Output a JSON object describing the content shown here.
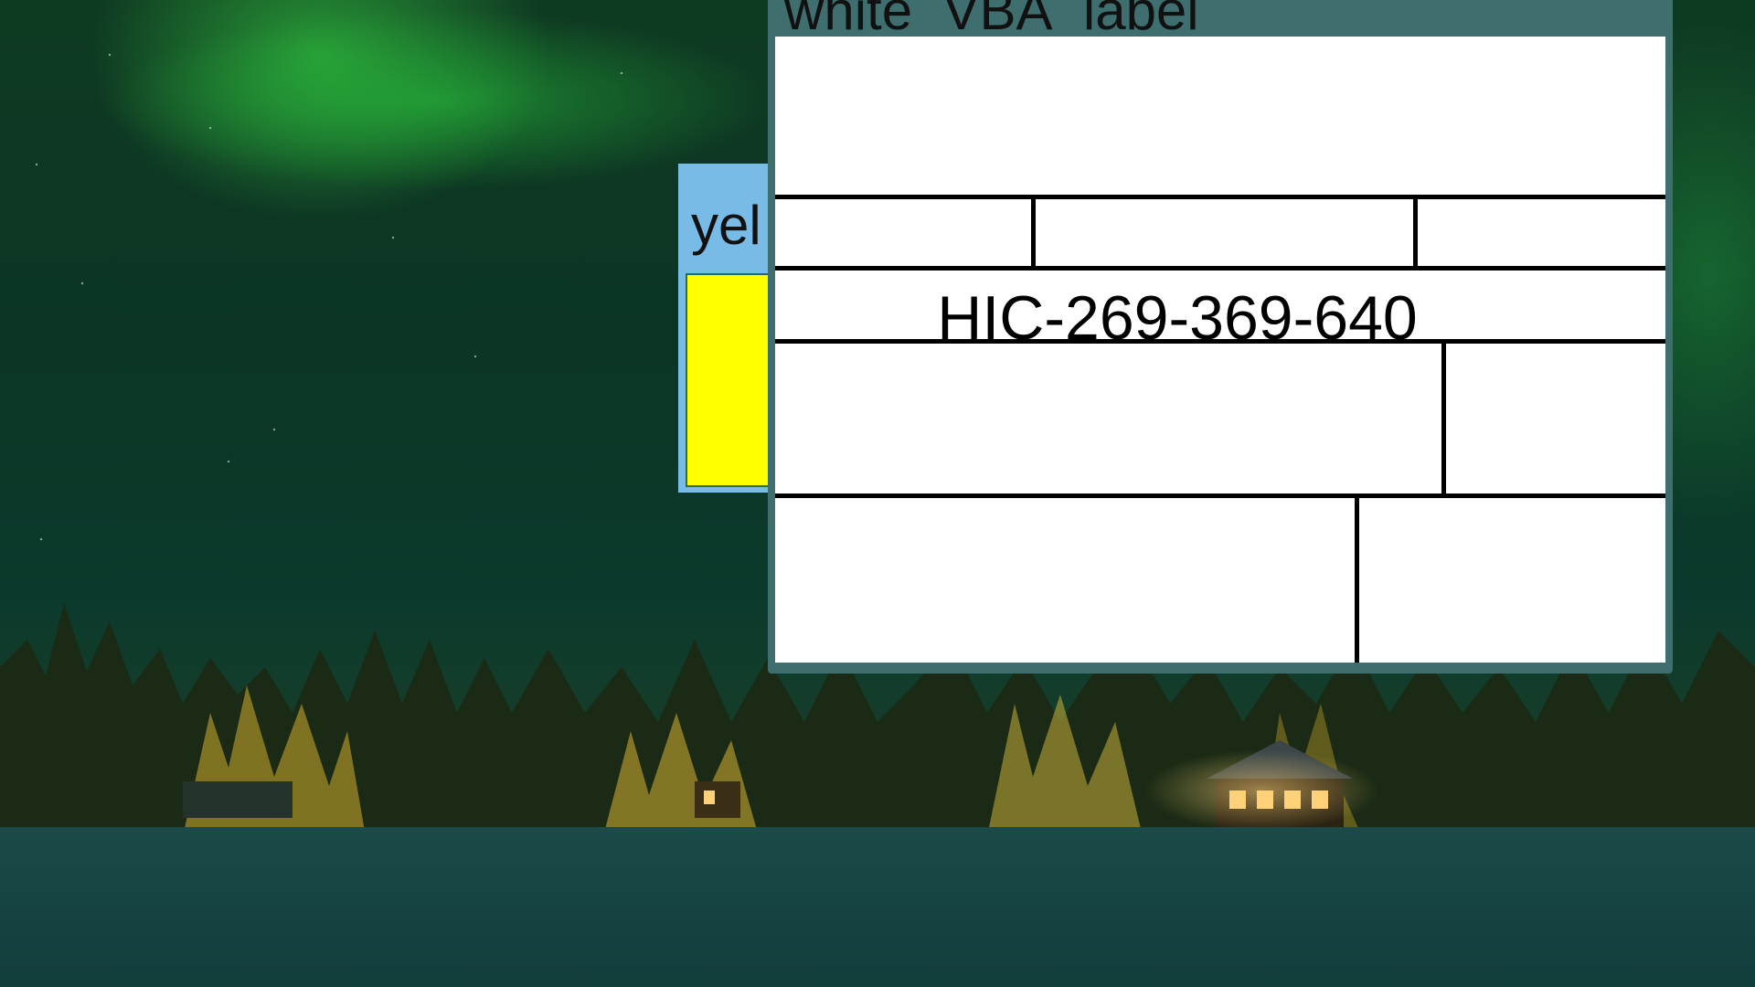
{
  "windows": {
    "yellow": {
      "title": "yel"
    },
    "white": {
      "title": "white_VBA_label",
      "label": {
        "serial": "HIC-269-369-640"
      }
    }
  },
  "colors": {
    "yellow_window_frame": "#77bbe6",
    "yellow_fill": "#ffff00",
    "white_window_frame": "#3f6e6e",
    "label_background": "#ffffff",
    "grid_lines": "#000000"
  }
}
